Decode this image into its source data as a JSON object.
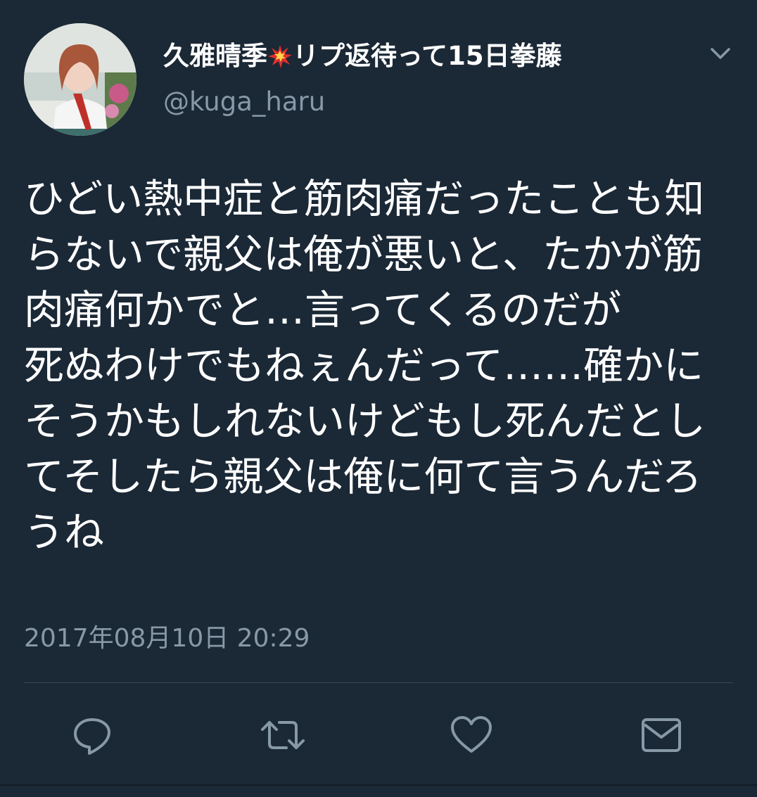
{
  "user": {
    "display_name": "久雅晴季",
    "display_name_emoji": "collision-emoji",
    "display_name_suffix": "リプ返待って15日拳藤",
    "handle": "@kuga_haru"
  },
  "tweet": {
    "text": "ひどい熱中症と筋肉痛だったことも知らないで親父は俺が悪いと、たかが筋肉痛何かでと…言ってくるのだが\n死ぬわけでもねぇんだって……確かにそうかもしれないけどもし死んだとしてそしたら親父は俺に何て言うんだろうね",
    "timestamp": "2017年08月10日 20:29"
  },
  "icons": {
    "menu": "chevron-down-icon",
    "reply": "reply-icon",
    "retweet": "retweet-icon",
    "like": "heart-icon",
    "share": "mail-icon"
  },
  "colors": {
    "background": "#1b2836",
    "text": "#ffffff",
    "secondary_text": "#8899a6",
    "icon": "#8899a6",
    "divider": "#38444d",
    "emoji_red": "#e0302b"
  }
}
